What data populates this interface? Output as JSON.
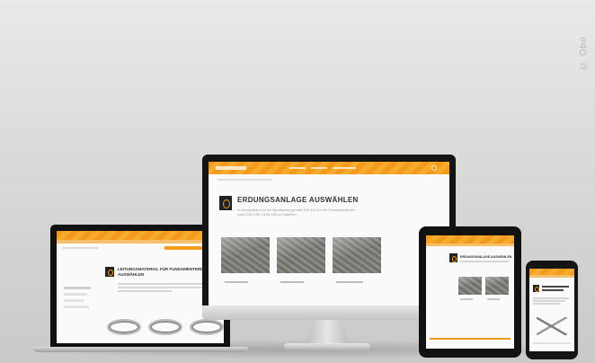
{
  "watermark": "© Obo",
  "monitor": {
    "heading": "ERDUNGSANLAGE AUSWÄHLEN",
    "intro_line1": "In Deutschland ist bei Neubauten gemäß DIN 18 014 ein Fundamenterder",
    "intro_line2": "nach DIN VDE 0100-540 zu erstellen."
  },
  "laptop": {
    "heading_line1": "LEITUNGSMATERIAL FÜR FUNDAMENTERDER",
    "heading_line2": "AUSWÄHLEN"
  },
  "tablet": {
    "heading": "ERDUNGSANLAGE AUSWÄHLEN"
  },
  "colors": {
    "accent": "#f39a1b",
    "bezel": "#141414",
    "background": "#dcdcda"
  }
}
